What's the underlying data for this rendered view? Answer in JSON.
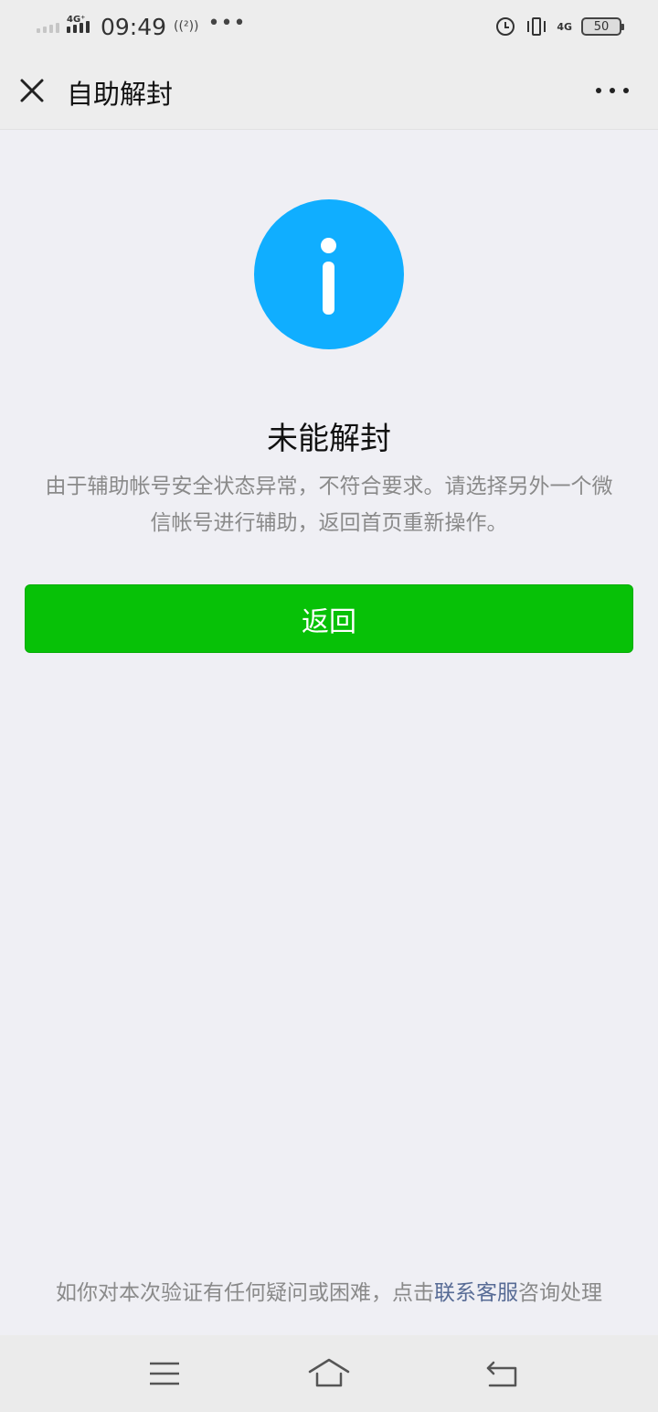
{
  "status_bar": {
    "network_left": "4G⁺",
    "time": "09:49",
    "hotspot": "((²))",
    "more": "•••",
    "network_right": "4G",
    "battery": "50"
  },
  "nav": {
    "title": "自助解封",
    "close_icon": "close-icon",
    "more_icon": "more-icon"
  },
  "result": {
    "icon": "info-icon",
    "icon_color": "#10aeff",
    "title": "未能解封",
    "description": "由于辅助帐号安全状态异常，不符合要求。请选择另外一个微信帐号进行辅助，返回首页重新操作。"
  },
  "actions": {
    "back_label": "返回",
    "button_color": "#07c107"
  },
  "footer": {
    "prefix": "如你对本次验证有任何疑问或困难，点击",
    "link": "联系客服",
    "suffix": "咨询处理",
    "link_color": "#576b95"
  }
}
